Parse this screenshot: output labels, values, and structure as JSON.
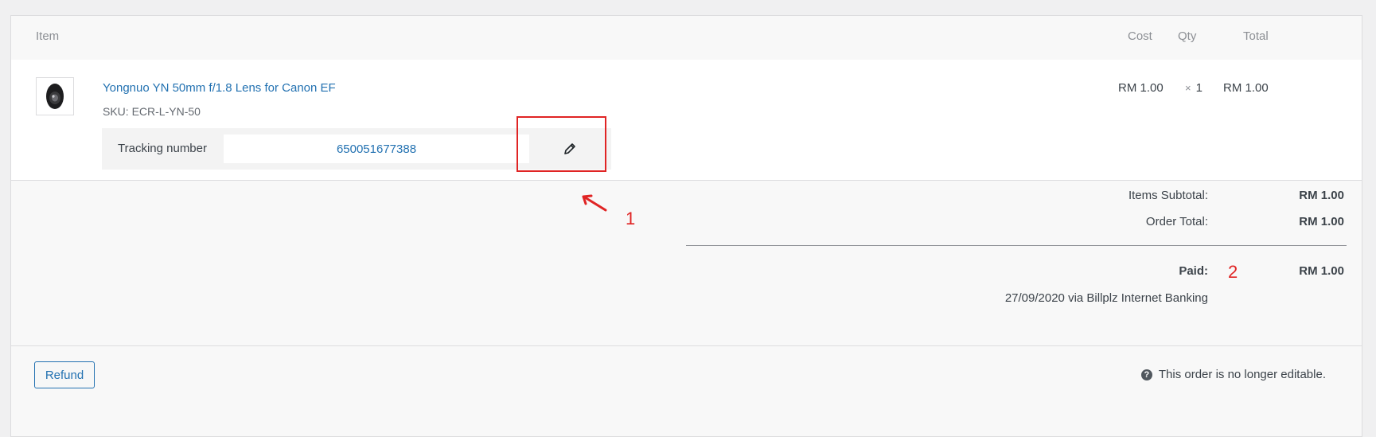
{
  "header": {
    "item": "Item",
    "cost": "Cost",
    "qty": "Qty",
    "total": "Total"
  },
  "product": {
    "name": "Yongnuo YN 50mm f/1.8 Lens for Canon EF",
    "sku_label": "SKU:",
    "sku_value": "ECR-L-YN-50",
    "cost": "RM 1.00",
    "qty_symbol": "×",
    "qty": "1",
    "total": "RM 1.00",
    "thumb_icon": "camera-lens-icon"
  },
  "tracking": {
    "label": "Tracking number",
    "value": "650051677388",
    "edit_icon": "pencil-icon"
  },
  "totals": {
    "subtotal_label": "Items Subtotal:",
    "subtotal_value": "RM 1.00",
    "order_total_label": "Order Total:",
    "order_total_value": "RM 1.00",
    "paid_label": "Paid:",
    "paid_value": "RM 1.00",
    "paid_note": "27/09/2020 via Billplz Internet Banking"
  },
  "footer": {
    "refund_label": "Refund",
    "notice": "This order is no longer editable.",
    "notice_icon": "help-icon"
  },
  "annotations": {
    "marker_1": "1",
    "marker_2": "2",
    "color": "#e02424"
  },
  "colors": {
    "link": "#2271b1",
    "panel_bg": "#f8f8f8"
  }
}
